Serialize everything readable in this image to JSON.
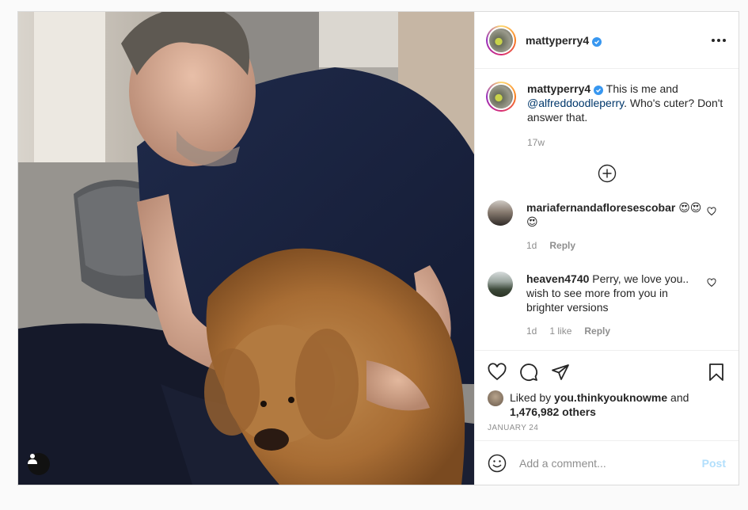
{
  "post": {
    "username": "mattyperry4",
    "verified": true,
    "caption": {
      "username": "mattyperry4",
      "text_before": " This is me and ",
      "mention": "@alfreddoodleperry",
      "text_after": ". Who's cuter? Don't answer that.",
      "age": "17w"
    },
    "comments": [
      {
        "username": "mariafernandafloresescobar",
        "text": " 😍😍😍",
        "age": "1d",
        "reply_label": "Reply"
      },
      {
        "username": "heaven4740",
        "text": " Perry, we love you.. wish to see more from you in brighter versions",
        "age": "1d",
        "likes": "1 like",
        "reply_label": "Reply"
      }
    ],
    "likes": {
      "prefix": "Liked by ",
      "user": "you.thinkyouknowme",
      "middle": " and",
      "count": "1,476,982 others"
    },
    "date": "JANUARY 24",
    "add_comment": {
      "placeholder": "Add a comment...",
      "post_label": "Post"
    },
    "colors": {
      "accent_blue": "#0095f6",
      "post_button_disabled": "#b2dffc",
      "verified": "#3897f0"
    },
    "icons": [
      "more-icon",
      "plus-circle-icon",
      "heart-icon",
      "comment-icon",
      "share-icon",
      "bookmark-icon",
      "emoji-icon",
      "user-tag-icon"
    ]
  }
}
